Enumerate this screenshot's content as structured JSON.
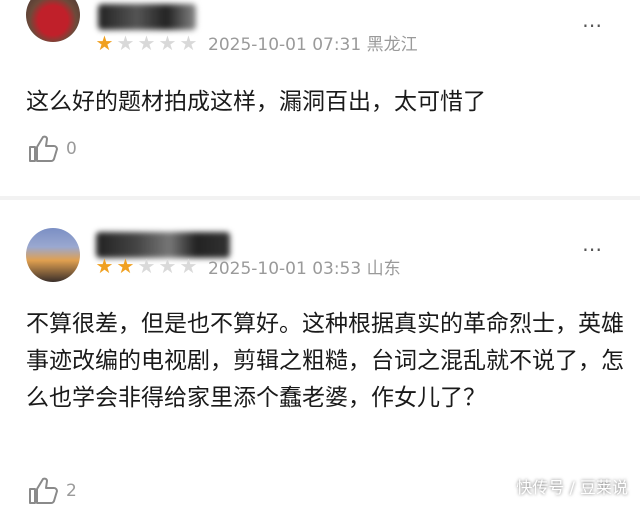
{
  "reviews": [
    {
      "rating_stars": 1,
      "date": "2025-10-01 07:31",
      "location": "黑龙江",
      "content": "这么好的题材拍成这样，漏洞百出，太可惜了",
      "likes": "0"
    },
    {
      "rating_stars": 2,
      "date": "2025-10-01 03:53",
      "location": "山东",
      "content": "不算很差，但是也不算好。这种根据真实的革命烈士，英雄事迹改编的电视剧，剪辑之粗糙，台词之混乱就不说了，怎么也学会非得给家里添个蠢老婆，作女儿了？",
      "likes": "2"
    }
  ],
  "more_icon": "⋯",
  "watermark": "快传号 / 豆莱说",
  "colors": {
    "star_on": "#f0a020",
    "star_off": "#d9d9d9",
    "meta": "#9a9a9a"
  }
}
